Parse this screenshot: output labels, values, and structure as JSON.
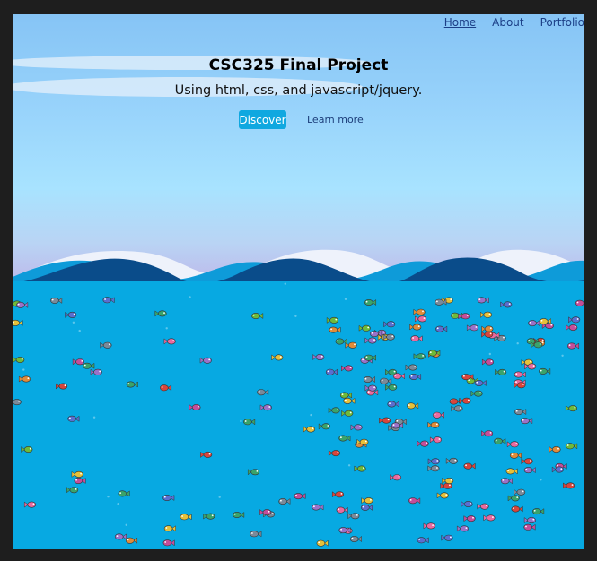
{
  "nav": {
    "items": [
      {
        "label": "Home",
        "active": true
      },
      {
        "label": "About",
        "active": false
      },
      {
        "label": "Portfolio",
        "active": false
      }
    ]
  },
  "hero": {
    "title": "CSC325 Final Project",
    "subtitle": "Using html, css, and javascript/jquery.",
    "primary_button": "Discover",
    "secondary_link": "Learn more"
  },
  "colors": {
    "ocean": "#07a9e2",
    "wave_dark": "#0a4c8a",
    "wave_light": "#0e9bd9",
    "wave_foam": "#eef2fb",
    "button": "#10a8e0"
  },
  "fish_colors": [
    "#d8453c",
    "#6fba3a",
    "#9a72c8",
    "#e08c3a",
    "#c44e9a",
    "#7a8a9a",
    "#e6c13a",
    "#3aa36b",
    "#5a6fd0",
    "#ea6aa0"
  ]
}
